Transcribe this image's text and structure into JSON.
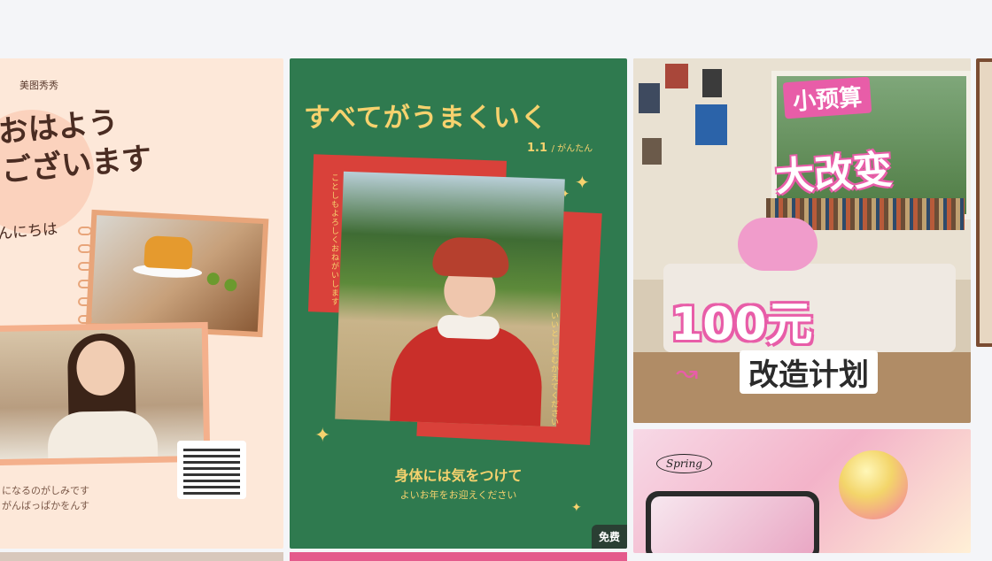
{
  "cards": {
    "morning": {
      "brand": "美图秀秀",
      "title_line1": "おはよう",
      "title_line2": "ございます",
      "subtitle": "んにちは",
      "footer_line1": "になるのがしみです",
      "footer_line2": "がんばっぱかをんす"
    },
    "green": {
      "title": "すべてがうまくいく",
      "date": "1.1",
      "date_sub": "/ がんたん",
      "vertical_left": "ことしもよろしくおねがいします",
      "vertical_right": "いいとしをむかえてください",
      "line1": "身体には気をつけて",
      "line2": "よいお年をお迎えください",
      "badge": "免费",
      "colors": {
        "background": "#2f7a4f",
        "accent": "#f6d26e",
        "frame": "#d9413a"
      }
    },
    "room": {
      "line_small": "小预算",
      "line_big": "大改变",
      "line_money": "100元",
      "line_plan": "改造计划",
      "colors": {
        "accent": "#e85da8"
      }
    },
    "spring": {
      "tag": "Spring"
    }
  }
}
